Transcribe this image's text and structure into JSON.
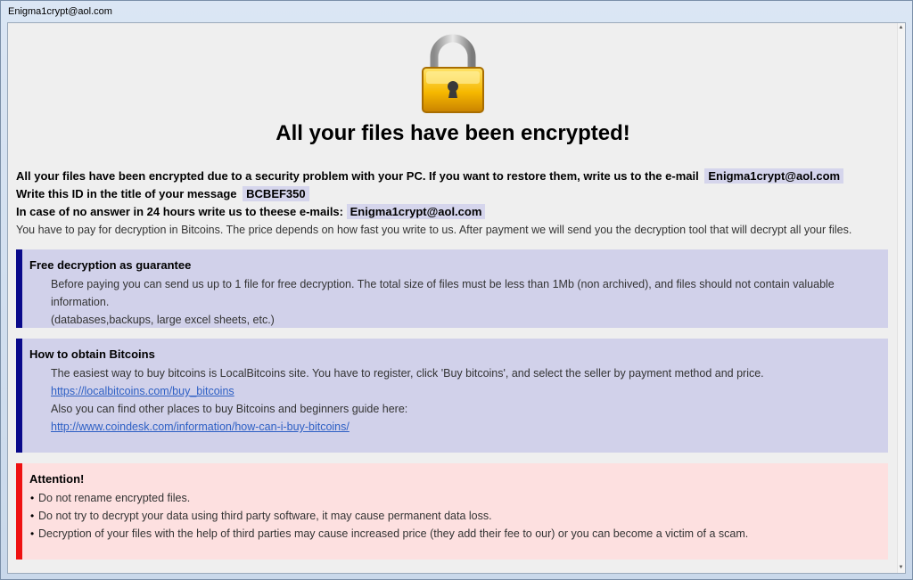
{
  "window": {
    "title": "Enigma1crypt@aol.com"
  },
  "headline": "All your files have been encrypted!",
  "intro": {
    "line1_text": "All your files have been encrypted due to a security problem with your PC. If you want to restore them, write us to the e-mail",
    "line1_email": "Enigma1crypt@aol.com",
    "line2_text": "Write this ID in the title of your message",
    "line2_id": "BCBEF350",
    "line3_text": "In case of no answer in 24 hours write us to theese e-mails:",
    "line3_email": "Enigma1crypt@aol.com",
    "payment_text": "You have to pay for decryption in Bitcoins. The price depends on how fast you write to us. After payment we will send you the decryption tool that will decrypt all your files."
  },
  "guarantee": {
    "title": "Free decryption as guarantee",
    "line1": "Before paying you can send us up to 1 file for free decryption. The total size of files must be less than 1Mb (non archived), and files should not contain valuable information.",
    "line2": "(databases,backups, large excel sheets, etc.)"
  },
  "bitcoins": {
    "title": "How to obtain Bitcoins",
    "line1": "The easiest way to buy bitcoins is LocalBitcoins site. You have to register, click 'Buy bitcoins', and select the seller by payment method and price.",
    "link1": "https://localbitcoins.com/buy_bitcoins",
    "line2": "Also you can find other places to buy Bitcoins and beginners guide here:",
    "link2": "http://www.coindesk.com/information/how-can-i-buy-bitcoins/"
  },
  "attention": {
    "title": "Attention!",
    "items": [
      "Do not rename encrypted files.",
      "Do not try to decrypt your data using third party software, it may cause permanent data loss.",
      "Decryption of your files with the help of third parties may cause increased price (they add their fee to our) or you can become a victim of a scam."
    ]
  },
  "colors": {
    "blue_box": "#d1d1ea",
    "blue_border": "#0a0a8a",
    "red_box": "#fde0e0",
    "red_border": "#ee1111"
  },
  "icons": {
    "lock": "padlock-icon",
    "scroll_up": "scroll-up-arrow-icon",
    "scroll_down": "scroll-down-arrow-icon"
  }
}
